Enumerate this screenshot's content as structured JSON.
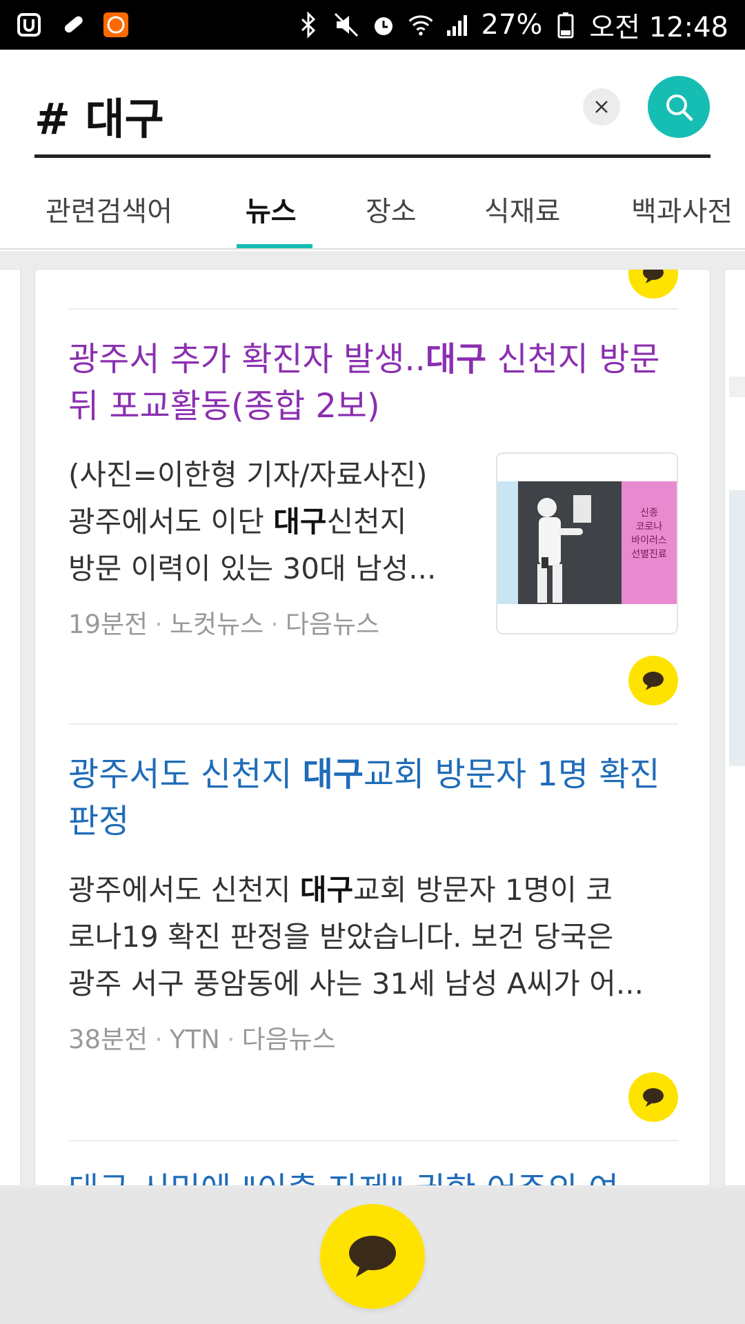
{
  "status_bar": {
    "battery": "27%",
    "time": "오전 12:48"
  },
  "search": {
    "query": "# 대구"
  },
  "tabs": [
    {
      "label": "관련검색어"
    },
    {
      "label": "뉴스"
    },
    {
      "label": "장소"
    },
    {
      "label": "식재료"
    },
    {
      "label": "백과사전"
    }
  ],
  "articles": [
    {
      "title_pre": "광주서 추가 확진자 발생..",
      "title_bold": "대구",
      "title_post": " 신천지 방문 뒤 포교활동(종합 2보)",
      "snippet_line1": "(사진=이한형 기자/자료사진)",
      "snippet_line2_pre": "광주에서도 이단 ",
      "snippet_line2_bold": "대구",
      "snippet_line2_post": "신천지",
      "snippet_line3": "방문 이력이 있는 30대 남성...",
      "time": "19분전",
      "source": "노컷뉴스",
      "portal": "다음뉴스",
      "thumb_sign_lines": [
        "신종",
        "코로나",
        "바이러스",
        "선별진료"
      ]
    },
    {
      "title_pre": "광주서도 신천지 ",
      "title_bold": "대구",
      "title_post": "교회 방문자 1명 확진 판정",
      "snippet_line1_pre": "광주에서도 신천지 ",
      "snippet_line1_bold": "대구",
      "snippet_line1_post": "교회 방문자 1명이 코",
      "snippet_line2": "로나19 확진 판정을 받았습니다. 보건 당국은",
      "snippet_line3": "광주 서구 풍암동에 사는 31세 남성 A씨가 어...",
      "time": "38분전",
      "source": "YTN",
      "portal": "다음뉴스"
    }
  ],
  "partial_title": "대구 시민에 \"이출 자제\" 권한 어주의 여",
  "colors": {
    "accent": "#16bdb2",
    "visited_link": "#8b2fb0",
    "link": "#1f6cb8",
    "kakao_yellow": "#ffe300"
  },
  "icons": {
    "search": "search-icon",
    "clear": "close-icon",
    "chat": "chat-bubble-icon"
  }
}
